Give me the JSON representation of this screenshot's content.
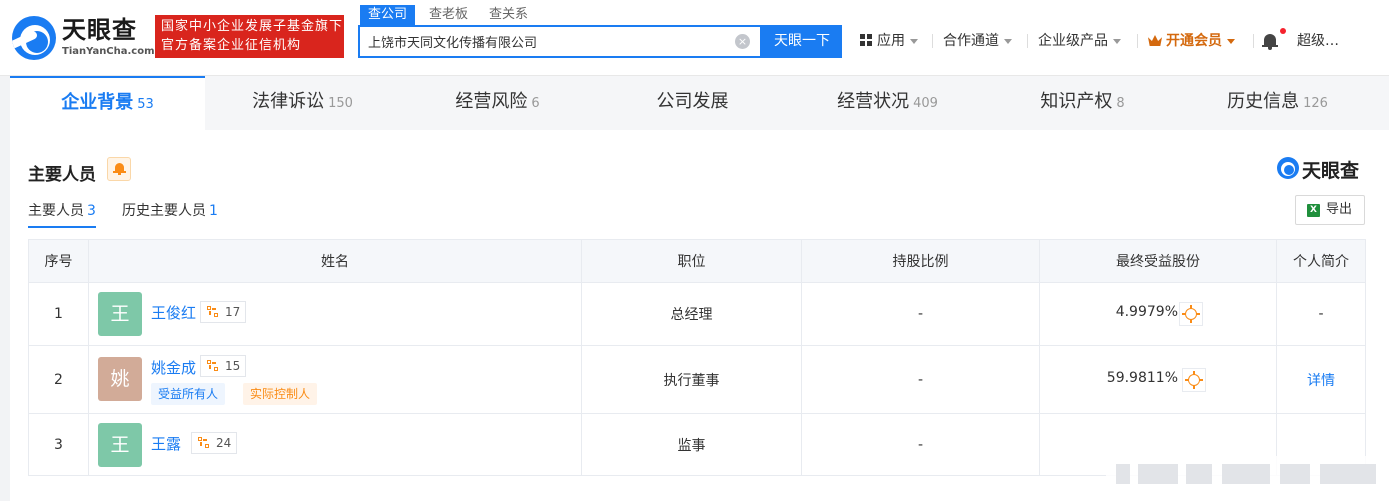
{
  "header": {
    "logo_text": "天眼查",
    "logo_sub": "TianYanCha.com",
    "gov_line1": "国家中小企业发展子基金旗下",
    "gov_line2": "官方备案企业征信机构",
    "search_tabs": [
      "查公司",
      "查老板",
      "查关系"
    ],
    "search_value": "上饶市天同文化传播有限公司",
    "search_button": "天眼一下",
    "nav": {
      "apps": "应用",
      "channel": "合作通道",
      "enterprise": "企业级产品",
      "vip": "开通会员",
      "user": "超级…"
    }
  },
  "category_tabs": [
    {
      "label": "企业背景",
      "count": "53"
    },
    {
      "label": "法律诉讼",
      "count": "150"
    },
    {
      "label": "经营风险",
      "count": "6"
    },
    {
      "label": "公司发展",
      "count": ""
    },
    {
      "label": "经营状况",
      "count": "409"
    },
    {
      "label": "知识产权",
      "count": "8"
    },
    {
      "label": "历史信息",
      "count": "126"
    }
  ],
  "section": {
    "title": "主要人员",
    "brand": "天眼查",
    "subtabs": [
      {
        "label": "主要人员",
        "count": "3"
      },
      {
        "label": "历史主要人员",
        "count": "1"
      }
    ],
    "export_label": "导出",
    "excel_glyph": "X"
  },
  "table": {
    "headers": [
      "序号",
      "姓名",
      "职位",
      "持股比例",
      "最终受益股份",
      "个人简介"
    ],
    "rows": [
      {
        "index": "1",
        "avatar": "王",
        "avatar_color": "#7ec8a8",
        "name": "王俊红",
        "relations": "17",
        "tags": [],
        "position": "总经理",
        "ratio": "-",
        "benefit": "4.9979%",
        "profile": "-"
      },
      {
        "index": "2",
        "avatar": "姚",
        "avatar_color": "#d2ab98",
        "name": "姚金成",
        "relations": "15",
        "tags": [
          "受益所有人",
          "实际控制人"
        ],
        "position": "执行董事",
        "ratio": "-",
        "benefit": "59.9811%",
        "profile": "详情"
      },
      {
        "index": "3",
        "avatar": "王",
        "avatar_color": "#7ec8a8",
        "name": "王露",
        "relations": "24",
        "tags": [],
        "position": "监事",
        "ratio": "-",
        "benefit": "",
        "profile": ""
      }
    ]
  },
  "colors": {
    "accent": "#1a7cf2",
    "gov_red": "#d9251d",
    "vip_orange": "#d4690e",
    "tag_orange": "#fa8c16"
  }
}
